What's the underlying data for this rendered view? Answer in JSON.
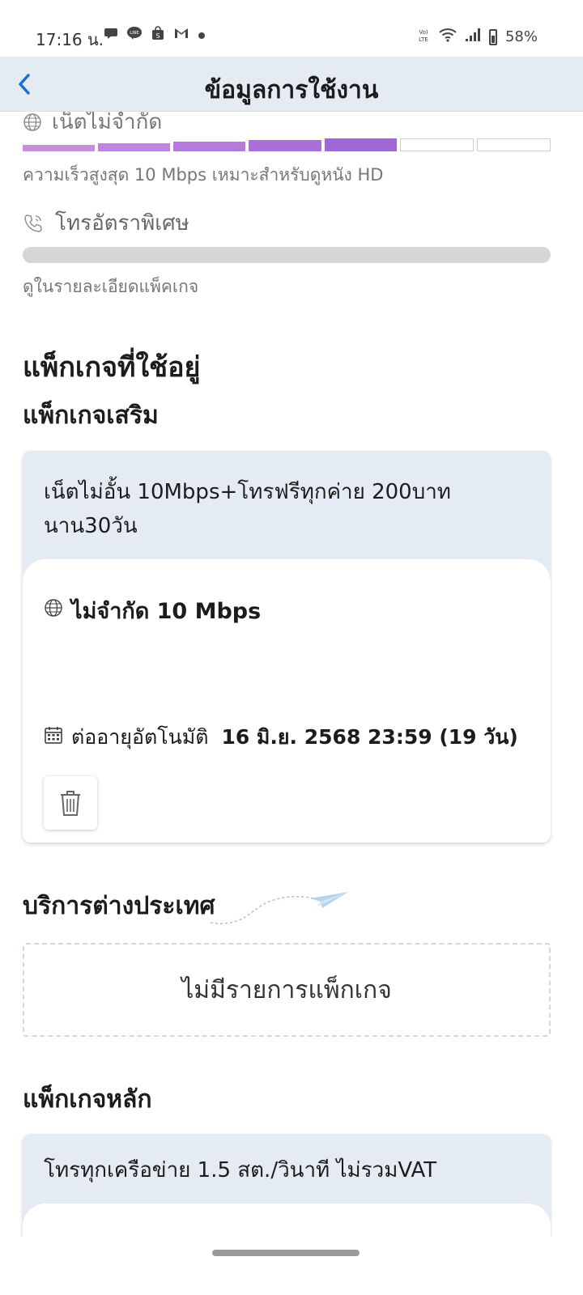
{
  "status_bar": {
    "time": "17:16 น.",
    "battery": "58%",
    "network": "VoLTE"
  },
  "header": {
    "title": "ข้อมูลการใช้งาน"
  },
  "usage": {
    "internet_partial_label": "เน็ตไม่จำกัด",
    "internet_segments_total": 7,
    "internet_segments_filled": 5,
    "internet_segment_colors": [
      "#c78ee0",
      "#bf85de",
      "#b47bdc",
      "#a970da",
      "#9f66d6"
    ],
    "internet_caption": "ความเร็วสูงสุด 10 Mbps เหมาะสำหรับดูหนัง HD",
    "call_label": "โทรอัตราพิเศษ",
    "call_caption": "ดูในรายละเอียดแพ็คเกจ"
  },
  "sections": {
    "current_packages": "แพ็กเกจที่ใช้อยู่",
    "addon_packages": "แพ็กเกจเสริม",
    "international": "บริการต่างประเทศ",
    "main_package": "แพ็กเกจหลัก"
  },
  "addon_card": {
    "title": "เน็ตไม่อั้น 10Mbps+โทรฟรีทุกค่าย 200บาท นาน30วัน",
    "speed": "ไม่จำกัด 10 Mbps",
    "renew_label": "ต่ออายุอัตโนมัติ",
    "renew_date": "16 มิ.ย. 2568 23:59 (19 วัน)"
  },
  "international": {
    "empty_text": "ไม่มีรายการแพ็กเกจ"
  },
  "main_card": {
    "title": "โทรทุกเครือข่าย 1.5 สต./วินาที ไม่รวมVAT"
  },
  "colors": {
    "header_bg": "#e4ebf2",
    "accent_blue": "#1a73c9",
    "gray_bar": "#d6d6d6"
  }
}
